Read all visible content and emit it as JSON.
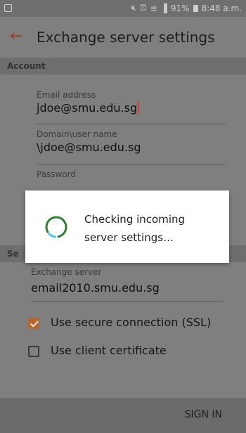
{
  "status_bar": {
    "battery_percent": "91%",
    "time": "8:48 a.m.",
    "icons": [
      "gallery-icon",
      "mute-icon",
      "alarm-icon",
      "wifi-icon",
      "signal-icon",
      "battery-icon"
    ]
  },
  "app_bar": {
    "title": "Exchange server settings",
    "back_icon": "arrow-left-icon"
  },
  "account": {
    "section_title": "Account",
    "email_label": "Email address",
    "email_value": "jdoe@smu.edu.sg",
    "domain_label": "Domain\\user name",
    "domain_value": "\\jdoe@smu.edu.sg",
    "password_label": "Password"
  },
  "server": {
    "section_title_partial": "Se",
    "exchange_label": "Exchange server",
    "exchange_value": "email2010.smu.edu.sg",
    "ssl_label": "Use secure connection (SSL)",
    "ssl_checked": true,
    "cert_label": "Use client certificate",
    "cert_checked": false
  },
  "dialog": {
    "message": "Checking incoming server settings…",
    "spinner_colors": [
      "#2e7d32",
      "#4fc3f7"
    ]
  },
  "bottom_bar": {
    "sign_in_label": "SIGN IN"
  },
  "colors": {
    "accent": "#b5652e",
    "back_arrow": "#9e3a2a"
  }
}
